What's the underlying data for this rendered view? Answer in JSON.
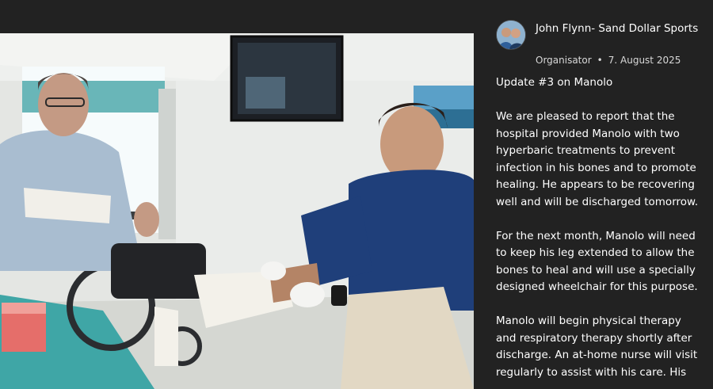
{
  "author": {
    "name": "John Flynn- Sand Dollar Sports",
    "role": "Organisator",
    "separator": "•",
    "date": "7. August 2025"
  },
  "post": {
    "title": "Update #3 on Manolo",
    "paragraphs": [
      "We are pleased to report that the hospital provided Manolo with two hyperbaric treatments to prevent infection in his bones and to promote healing. He appears to be recovering well and will be discharged tomorrow.",
      "For the next month, Manolo will need to keep his leg extended to allow the bones to heal and will use a specially designed wheelchair for this purpose.",
      "Manolo will begin physical therapy and respiratory therapy shortly after discharge. An at-home nurse will visit regularly to assist with his care. His"
    ]
  },
  "photo": {
    "subject": "patient-in-wheelchair-with-nurse-hospital-room"
  },
  "colors": {
    "background": "#222222",
    "text": "#ffffff",
    "meta_text": "#d8d8d8"
  }
}
